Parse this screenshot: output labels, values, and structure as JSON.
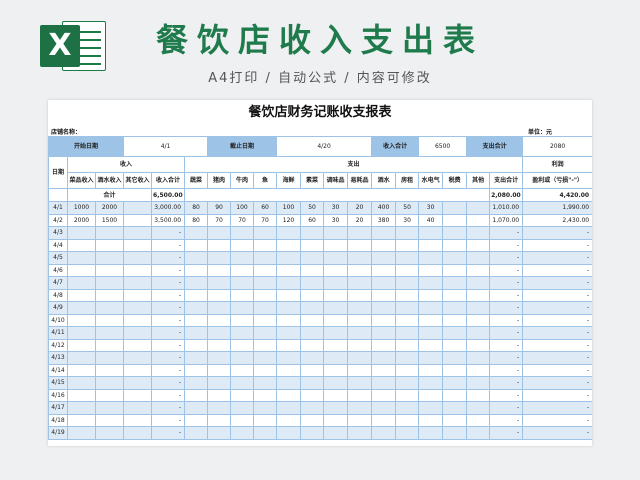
{
  "logo": {
    "letter": "X"
  },
  "title": "餐饮店收入支出表",
  "subtitle": "A4打印 / 自动公式 / 内容可修改",
  "sheet": {
    "title": "餐饮店财务记账收支报表",
    "store_label": "店铺名称：",
    "unit_label": "单位：元",
    "info": {
      "start_label": "开始日期",
      "start_value": "4/1",
      "end_label": "截止日期",
      "end_value": "4/20",
      "income_total_label": "收入合计",
      "income_total_value": "6500",
      "expense_total_label": "支出合计",
      "expense_total_value": "2080"
    },
    "headers": {
      "date": "日期",
      "income_group": "收入",
      "expense_group": "支出",
      "profit_group": "利润",
      "profit_sub": "盈利或（亏损\"-\"）",
      "income_cols": [
        "菜品收入",
        "酒水收入",
        "其它收入",
        "收入合计"
      ],
      "expense_cols": [
        "蔬菜",
        "猪肉",
        "牛肉",
        "鱼",
        "海鲜",
        "素菜",
        "调味品",
        "易耗品",
        "酒水",
        "房租",
        "水电气",
        "税费",
        "其他",
        "支出合计"
      ]
    },
    "total_row": {
      "label": "合计",
      "income_sum": "6,500.00",
      "expense_sum": "2,080.00",
      "profit": "4,420.00"
    },
    "rows": [
      {
        "date": "4/1",
        "dish": "1000",
        "drink": "2000",
        "other": "",
        "income": "3,000.00",
        "veg": "80",
        "pork": "90",
        "beef": "100",
        "fish": "60",
        "seafood": "100",
        "vegetarian": "50",
        "seasoning": "30",
        "consumables": "20",
        "liquor": "400",
        "rent": "50",
        "utility": "30",
        "tax": "",
        "others": "",
        "expense": "1,010.00",
        "profit": "1,990.00"
      },
      {
        "date": "4/2",
        "dish": "2000",
        "drink": "1500",
        "other": "",
        "income": "3,500.00",
        "veg": "80",
        "pork": "70",
        "beef": "70",
        "fish": "70",
        "seafood": "120",
        "vegetarian": "60",
        "seasoning": "30",
        "consumables": "20",
        "liquor": "380",
        "rent": "30",
        "utility": "40",
        "tax": "",
        "others": "",
        "expense": "1,070.00",
        "profit": "2,430.00"
      },
      {
        "date": "4/3",
        "income": "-",
        "expense": "-",
        "profit": "-"
      },
      {
        "date": "4/4",
        "income": "-",
        "expense": "-",
        "profit": "-"
      },
      {
        "date": "4/5",
        "income": "-",
        "expense": "-",
        "profit": "-"
      },
      {
        "date": "4/6",
        "income": "-",
        "expense": "-",
        "profit": "-"
      },
      {
        "date": "4/7",
        "income": "-",
        "expense": "-",
        "profit": "-"
      },
      {
        "date": "4/8",
        "income": "-",
        "expense": "-",
        "profit": "-"
      },
      {
        "date": "4/9",
        "income": "-",
        "expense": "-",
        "profit": "-"
      },
      {
        "date": "4/10",
        "income": "-",
        "expense": "-",
        "profit": "-"
      },
      {
        "date": "4/11",
        "income": "-",
        "expense": "-",
        "profit": "-"
      },
      {
        "date": "4/12",
        "income": "-",
        "expense": "-",
        "profit": "-"
      },
      {
        "date": "4/13",
        "income": "-",
        "expense": "-",
        "profit": "-"
      },
      {
        "date": "4/14",
        "income": "-",
        "expense": "-",
        "profit": "-"
      },
      {
        "date": "4/15",
        "income": "-",
        "expense": "-",
        "profit": "-"
      },
      {
        "date": "4/16",
        "income": "-",
        "expense": "-",
        "profit": "-"
      },
      {
        "date": "4/17",
        "income": "-",
        "expense": "-",
        "profit": "-"
      },
      {
        "date": "4/18",
        "income": "-",
        "expense": "-",
        "profit": "-"
      },
      {
        "date": "4/19",
        "income": "-",
        "expense": "-",
        "profit": "-"
      }
    ]
  },
  "colors": {
    "accent": "#1f7a4c",
    "header_fill": "#9dc3e6",
    "stripe": "#deebf7",
    "grid": "#9dc3e6"
  }
}
